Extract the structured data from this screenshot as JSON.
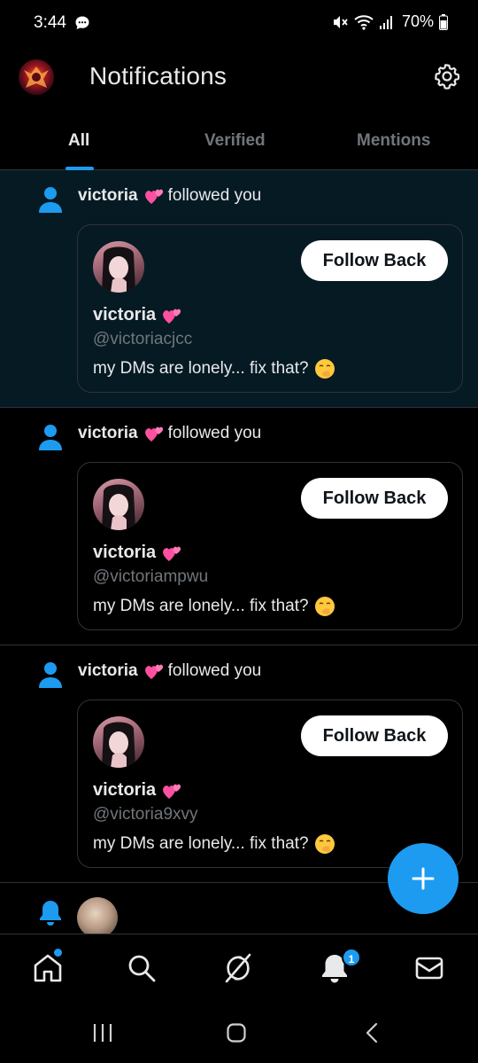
{
  "status_bar": {
    "time": "3:44",
    "battery": "70%"
  },
  "header": {
    "title": "Notifications"
  },
  "tabs": [
    {
      "label": "All",
      "active": true
    },
    {
      "label": "Verified",
      "active": false
    },
    {
      "label": "Mentions",
      "active": false
    }
  ],
  "notifications": [
    {
      "name": "victoria",
      "action": "followed you",
      "unread": true,
      "card": {
        "name": "victoria",
        "handle": "@victoriacjcc",
        "bio": "my DMs are lonely... fix that?",
        "button": "Follow Back"
      }
    },
    {
      "name": "victoria",
      "action": "followed you",
      "unread": false,
      "card": {
        "name": "victoria",
        "handle": "@victoriampwu",
        "bio": "my DMs are lonely... fix that?",
        "button": "Follow Back"
      }
    },
    {
      "name": "victoria",
      "action": "followed you",
      "unread": false,
      "card": {
        "name": "victoria",
        "handle": "@victoria9xvy",
        "bio": "my DMs are lonely... fix that?",
        "button": "Follow Back"
      }
    }
  ],
  "bottom_nav": {
    "items": [
      "home-icon",
      "search-icon",
      "grok-icon",
      "bell-icon",
      "mail-icon"
    ],
    "notification_badge": "1"
  },
  "colors": {
    "accent": "#1d9bf0",
    "unread_bg": "#061a24",
    "text": "#e7e9ea",
    "muted": "#71767b"
  }
}
